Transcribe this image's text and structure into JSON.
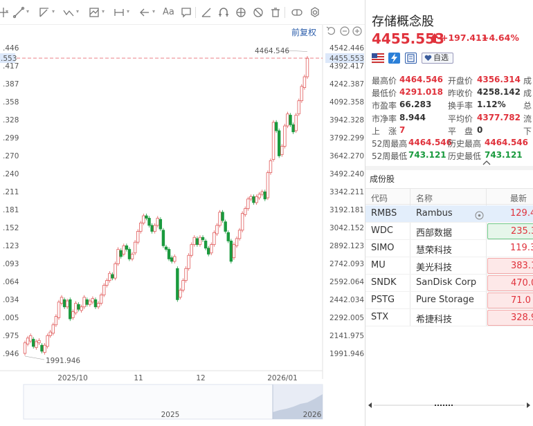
{
  "toolbar": {
    "icons": [
      "crosshair-icon",
      "line-tool-icon",
      "ray-tool-icon",
      "trend-tool-icon",
      "pattern-tool-icon",
      "range-tool-icon",
      "arrow-tool-icon",
      "text-tool-icon",
      "note-tool-icon",
      "ruler-icon",
      "magnet-icon",
      "eye-icon",
      "hide-icon",
      "trash-icon",
      "compare-icon",
      "settings-icon"
    ],
    "restore_label": "前复权",
    "controls": [
      "undo-icon",
      "zoom-out-icon",
      "zoom-in-icon"
    ]
  },
  "chart": {
    "left_ticks": [
      ".446",
      ".417",
      ".387",
      ".358",
      ".328",
      ".299",
      ".270",
      ".240",
      ".211",
      ".181",
      ".152",
      ".123",
      ".093",
      ".064",
      ".034",
      ".005",
      ".975",
      ".946"
    ],
    "left_current": ".553",
    "right_ticks": [
      "4542.446",
      "4392.417",
      "4242.387",
      "4092.358",
      "3942.328",
      "3792.299",
      "3642.270",
      "3492.240",
      "3342.211",
      "3192.181",
      "3042.152",
      "2892.123",
      "2742.093",
      "2592.064",
      "2442.034",
      "2292.005",
      "2141.975",
      "1991.946"
    ],
    "current_label": "4455.553",
    "high_label": "4464.546",
    "low_label": "1991.946",
    "x_ticks": [
      "2025/10",
      "11",
      "12",
      "2026/01"
    ],
    "nav_labels": [
      "2025",
      "2026"
    ],
    "colors": {
      "up": "#e05a5a",
      "down": "#1a9a3e",
      "current": "#e0323c"
    }
  },
  "chart_data": {
    "type": "candlestick",
    "y_range": [
      1991.946,
      4542.446
    ],
    "x_ticks": [
      "2025/10",
      "11",
      "12",
      "2026/01"
    ],
    "candles": [
      [
        1992,
        2080
      ],
      [
        2070,
        2120
      ],
      [
        2095,
        2140
      ],
      [
        2110,
        2050
      ],
      [
        2040,
        2090
      ],
      [
        2080,
        2100
      ],
      [
        2060,
        2010
      ],
      [
        2000,
        2060
      ],
      [
        2050,
        2140
      ],
      [
        2140,
        2170
      ],
      [
        2160,
        2230
      ],
      [
        2230,
        2300
      ],
      [
        2290,
        2420
      ],
      [
        2410,
        2460
      ],
      [
        2440,
        2380
      ],
      [
        2380,
        2430
      ],
      [
        2440,
        2280
      ],
      [
        2290,
        2340
      ],
      [
        2330,
        2410
      ],
      [
        2400,
        2360
      ],
      [
        2350,
        2380
      ],
      [
        2380,
        2460
      ],
      [
        2440,
        2400
      ],
      [
        2400,
        2430
      ],
      [
        2420,
        2450
      ],
      [
        2440,
        2380
      ],
      [
        2380,
        2410
      ],
      [
        2410,
        2480
      ],
      [
        2480,
        2560
      ],
      [
        2560,
        2600
      ],
      [
        2600,
        2660
      ],
      [
        2650,
        2620
      ],
      [
        2620,
        2740
      ],
      [
        2740,
        2860
      ],
      [
        2850,
        2800
      ],
      [
        2820,
        2890
      ],
      [
        2890,
        2860
      ],
      [
        2860,
        2780
      ],
      [
        2780,
        2820
      ],
      [
        2830,
        2920
      ],
      [
        2920,
        3010
      ],
      [
        3010,
        3080
      ],
      [
        3080,
        3140
      ],
      [
        3140,
        3120
      ],
      [
        3120,
        3060
      ],
      [
        3060,
        3010
      ],
      [
        3010,
        3060
      ],
      [
        3060,
        3120
      ],
      [
        3110,
        3030
      ],
      [
        3020,
        2890
      ],
      [
        2880,
        2860
      ],
      [
        2860,
        2780
      ],
      [
        2790,
        2760
      ],
      [
        2760,
        2800
      ],
      [
        2700,
        2440
      ],
      [
        2460,
        2520
      ],
      [
        2520,
        2600
      ],
      [
        2600,
        2700
      ],
      [
        2700,
        2810
      ],
      [
        2810,
        2900
      ],
      [
        2900,
        2960
      ],
      [
        2950,
        2900
      ],
      [
        2900,
        2960
      ],
      [
        2960,
        2940
      ],
      [
        2930,
        2870
      ],
      [
        2870,
        2820
      ],
      [
        2830,
        2900
      ],
      [
        2900,
        3000
      ],
      [
        2990,
        3060
      ],
      [
        3060,
        3170
      ],
      [
        3170,
        3100
      ],
      [
        3090,
        3010
      ],
      [
        3000,
        2930
      ],
      [
        2930,
        2760
      ],
      [
        2790,
        2900
      ],
      [
        2890,
        2950
      ],
      [
        2950,
        3020
      ],
      [
        3020,
        3160
      ],
      [
        3150,
        3200
      ],
      [
        3200,
        3280
      ],
      [
        3280,
        3300
      ],
      [
        3300,
        3250
      ],
      [
        3250,
        3300
      ],
      [
        3290,
        3320
      ],
      [
        3320,
        3340
      ],
      [
        3340,
        3280
      ],
      [
        3290,
        3500
      ],
      [
        3500,
        3600
      ],
      [
        3610,
        3920
      ],
      [
        3920,
        3850
      ],
      [
        3850,
        3640
      ],
      [
        3650,
        3720
      ],
      [
        3720,
        3890
      ],
      [
        3890,
        3990
      ],
      [
        3980,
        3900
      ],
      [
        3900,
        3840
      ],
      [
        3850,
        3980
      ],
      [
        3990,
        4100
      ],
      [
        4100,
        4220
      ],
      [
        4210,
        4300
      ],
      [
        4300,
        4455
      ]
    ]
  },
  "panel": {
    "name": "存储概念股",
    "price": "4455.553",
    "change": "+197.411",
    "pct": "+4.64%",
    "fav_label": "自选",
    "quotes": [
      [
        {
          "l": "最高价",
          "v": "4464.546",
          "c": "red"
        },
        {
          "l": "开盘价",
          "v": "4356.314",
          "c": "red"
        },
        {
          "l": "成",
          "v": "",
          "c": "dark"
        }
      ],
      [
        {
          "l": "最低价",
          "v": "4291.018",
          "c": "red"
        },
        {
          "l": "昨收价",
          "v": "4258.142",
          "c": "dark"
        },
        {
          "l": "成",
          "v": "",
          "c": "dark"
        }
      ],
      [
        {
          "l": "市盈率",
          "v": "66.283",
          "c": "dark"
        },
        {
          "l": "换手率",
          "v": "1.12%",
          "c": "dark"
        },
        {
          "l": "总",
          "v": "",
          "c": "dark"
        }
      ],
      [
        {
          "l": "市净率",
          "v": "8.944",
          "c": "dark"
        },
        {
          "l": "平均价",
          "v": "4377.782",
          "c": "red"
        },
        {
          "l": "流",
          "v": "",
          "c": "dark"
        }
      ],
      [
        {
          "l": "上　涨",
          "v": "7",
          "c": "red"
        },
        {
          "l": "平　盘",
          "v": "0",
          "c": "dark"
        },
        {
          "l": "下",
          "v": "",
          "c": "dark"
        }
      ],
      [
        {
          "l": "52周最高",
          "v": "4464.546",
          "c": "red"
        },
        {
          "l": "历史最高",
          "v": "4464.546",
          "c": "red"
        },
        {
          "l": "",
          "v": "",
          "c": "dark"
        }
      ],
      [
        {
          "l": "52周最低",
          "v": "743.121",
          "c": "green"
        },
        {
          "l": "历史最低",
          "v": "743.121",
          "c": "green"
        },
        {
          "l": "",
          "v": "",
          "c": "dark"
        }
      ]
    ],
    "constituents_title": "成份股",
    "col_code": "代码",
    "col_name": "名称",
    "col_price": "最新",
    "rows": [
      {
        "code": "RMBS",
        "name": "Rambus",
        "val": "129.4",
        "box": "",
        "sel": true
      },
      {
        "code": "WDC",
        "name": "西部数据",
        "val": "235.3",
        "box": "green",
        "sel": false
      },
      {
        "code": "SIMO",
        "name": "慧荣科技",
        "val": "119.3",
        "box": "",
        "sel": false
      },
      {
        "code": "MU",
        "name": "美光科技",
        "val": "383.1",
        "box": "red",
        "sel": false
      },
      {
        "code": "SNDK",
        "name": "SanDisk Corp",
        "val": "470.0",
        "box": "red",
        "sel": false
      },
      {
        "code": "PSTG",
        "name": "Pure Storage",
        "val": "71.0",
        "box": "red",
        "sel": false
      },
      {
        "code": "STX",
        "name": "希捷科技",
        "val": "328.9",
        "box": "red",
        "sel": false
      }
    ]
  }
}
